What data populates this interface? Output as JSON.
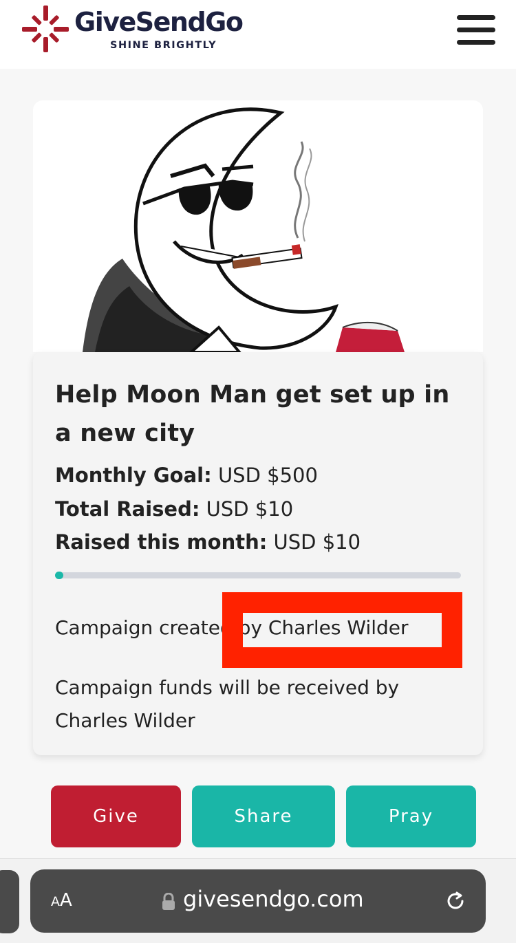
{
  "header": {
    "logo_text": "GiveSendGo",
    "logo_tagline": "SHINE BRIGHTLY",
    "logo_icon": "givesendgo-burst-logo",
    "menu_icon": "hamburger-menu-icon",
    "brand_color": "#1d2140",
    "accent_color": "#a81c2a"
  },
  "hero": {
    "image": "moon-man-illustration"
  },
  "campaign": {
    "title": "Help Moon Man get set up in a new city",
    "monthly_goal_label": "Monthly Goal:",
    "monthly_goal_value": "USD $500",
    "total_raised_label": "Total Raised:",
    "total_raised_value": "USD $10",
    "raised_month_label": "Raised this month:",
    "raised_month_value": "USD $10",
    "progress_fraction": 0.02,
    "created_by_prefix": "Campaign created by",
    "created_by_name": "Charles Wilder",
    "funds_text": "Campaign funds will be received by",
    "funds_name": "Charles Wilder"
  },
  "actions": {
    "give_label": "Give",
    "share_label": "Share",
    "pray_label": "Pray",
    "give_color": "#c01e32",
    "teal_color": "#1ab6a7"
  },
  "browser": {
    "text_size_label": "AA",
    "url": "givesendgo.com",
    "lock_icon": "lock-icon",
    "reload_icon": "reload-icon"
  }
}
